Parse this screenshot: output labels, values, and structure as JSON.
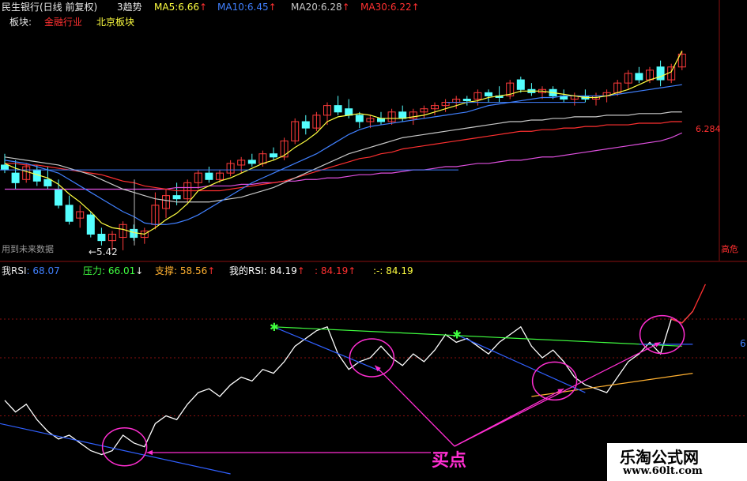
{
  "header": {
    "stock_title": "民生银行(日线 前复权)",
    "indicator_name": "3趋势",
    "ma": [
      {
        "label": "MA5:",
        "value": "6.66",
        "arrow": "↑",
        "color": "#ffff40"
      },
      {
        "label": "MA10:",
        "value": "6.45",
        "arrow": "↑",
        "color": "#4080ff"
      },
      {
        "label": "MA20:",
        "value": "6.28",
        "arrow": "↑",
        "color": "#c8c8c8"
      },
      {
        "label": "MA30:",
        "value": "6.22",
        "arrow": "↑",
        "color": "#ff3030"
      }
    ],
    "sector_label": "板块:",
    "sectors": [
      {
        "name": "金融行业",
        "color": "#ff3030"
      },
      {
        "name": "北京板块",
        "color": "#ffff40"
      }
    ]
  },
  "price_panel": {
    "right_price_label": "6.284",
    "low_label": "←5.42",
    "future_data_label": "用到未来数据",
    "right_edge_label": "高危"
  },
  "rsi_header": {
    "items": [
      {
        "label": "我RSI",
        "value": ": 68.07",
        "color": "#4080ff"
      },
      {
        "label": "压力",
        "value": ": 66.01",
        "arrow": "↓",
        "color": "#40ff40"
      },
      {
        "label": "支撑",
        "value": ": 58.56",
        "arrow": "↑",
        "color": "#ffb030"
      },
      {
        "label": "我的RSI",
        "value": ": 84.19",
        "arrow": "↑",
        "color": "#ffffff"
      },
      {
        "label": "",
        "value": ": 84.19",
        "arrow": "↑",
        "color": "#ff3030"
      },
      {
        "label": ":-",
        "value": ": 84.19",
        "color": "#ffff40"
      }
    ],
    "right_edge_value": "6"
  },
  "annotation": {
    "buy_point": "买点"
  },
  "watermark": {
    "title": "乐淘公式网",
    "url": "www.60lt.com"
  },
  "colors": {
    "up_candle": "#ff3b3b",
    "down_candle": "#54ffff",
    "ma5": "#ffff40",
    "ma10": "#4080ff",
    "ma20": "#c8c8c8",
    "ma30": "#ff3030",
    "long_ma": "#e050e0",
    "rsi": "#ffffff",
    "rsi_hot": "#ff3030",
    "pressure": "#40ff40",
    "support": "#ffb030",
    "trend": "#3060ff",
    "buy": "#ff2ed1"
  },
  "chart_data": {
    "type": "candlestick",
    "candles": [
      {
        "o": 5.95,
        "h": 6.02,
        "l": 5.9,
        "c": 5.92
      },
      {
        "o": 5.9,
        "h": 5.98,
        "l": 5.8,
        "c": 5.84
      },
      {
        "o": 5.86,
        "h": 5.96,
        "l": 5.84,
        "c": 5.94
      },
      {
        "o": 5.92,
        "h": 5.95,
        "l": 5.82,
        "c": 5.85
      },
      {
        "o": 5.86,
        "h": 5.94,
        "l": 5.8,
        "c": 5.82
      },
      {
        "o": 5.8,
        "h": 5.86,
        "l": 5.68,
        "c": 5.7
      },
      {
        "o": 5.7,
        "h": 5.76,
        "l": 5.58,
        "c": 5.6
      },
      {
        "o": 5.62,
        "h": 5.7,
        "l": 5.56,
        "c": 5.66
      },
      {
        "o": 5.64,
        "h": 5.66,
        "l": 5.5,
        "c": 5.52
      },
      {
        "o": 5.52,
        "h": 5.56,
        "l": 5.45,
        "c": 5.48
      },
      {
        "o": 5.48,
        "h": 5.54,
        "l": 5.42,
        "c": 5.52
      },
      {
        "o": 5.5,
        "h": 5.6,
        "l": 5.42,
        "c": 5.58
      },
      {
        "o": 5.55,
        "h": 5.58,
        "l": 5.48,
        "c": 5.5
      },
      {
        "o": 5.5,
        "h": 5.56,
        "l": 5.46,
        "c": 5.54
      },
      {
        "o": 5.58,
        "h": 5.78,
        "l": 5.55,
        "c": 5.7
      },
      {
        "o": 5.68,
        "h": 5.8,
        "l": 5.62,
        "c": 5.76
      },
      {
        "o": 5.76,
        "h": 5.84,
        "l": 5.7,
        "c": 5.74
      },
      {
        "o": 5.74,
        "h": 5.86,
        "l": 5.72,
        "c": 5.84
      },
      {
        "o": 5.84,
        "h": 5.92,
        "l": 5.8,
        "c": 5.9
      },
      {
        "o": 5.9,
        "h": 5.94,
        "l": 5.84,
        "c": 5.86
      },
      {
        "o": 5.86,
        "h": 5.92,
        "l": 5.84,
        "c": 5.9
      },
      {
        "o": 5.9,
        "h": 5.98,
        "l": 5.88,
        "c": 5.96
      },
      {
        "o": 5.95,
        "h": 6.0,
        "l": 5.9,
        "c": 5.98
      },
      {
        "o": 5.98,
        "h": 6.02,
        "l": 5.94,
        "c": 5.96
      },
      {
        "o": 5.96,
        "h": 6.04,
        "l": 5.94,
        "c": 6.02
      },
      {
        "o": 6.02,
        "h": 6.06,
        "l": 5.98,
        "c": 6.0
      },
      {
        "o": 6.0,
        "h": 6.12,
        "l": 5.98,
        "c": 6.1
      },
      {
        "o": 6.1,
        "h": 6.24,
        "l": 6.08,
        "c": 6.22
      },
      {
        "o": 6.22,
        "h": 6.26,
        "l": 6.14,
        "c": 6.18
      },
      {
        "o": 6.18,
        "h": 6.28,
        "l": 6.16,
        "c": 6.26
      },
      {
        "o": 6.26,
        "h": 6.34,
        "l": 6.2,
        "c": 6.32
      },
      {
        "o": 6.32,
        "h": 6.38,
        "l": 6.26,
        "c": 6.28
      },
      {
        "o": 6.3,
        "h": 6.36,
        "l": 6.24,
        "c": 6.26
      },
      {
        "o": 6.26,
        "h": 6.28,
        "l": 6.18,
        "c": 6.22
      },
      {
        "o": 6.22,
        "h": 6.26,
        "l": 6.18,
        "c": 6.24
      },
      {
        "o": 6.24,
        "h": 6.28,
        "l": 6.2,
        "c": 6.22
      },
      {
        "o": 6.22,
        "h": 6.3,
        "l": 6.2,
        "c": 6.28
      },
      {
        "o": 6.28,
        "h": 6.32,
        "l": 6.22,
        "c": 6.24
      },
      {
        "o": 6.24,
        "h": 6.3,
        "l": 6.2,
        "c": 6.28
      },
      {
        "o": 6.28,
        "h": 6.32,
        "l": 6.24,
        "c": 6.3
      },
      {
        "o": 6.3,
        "h": 6.34,
        "l": 6.26,
        "c": 6.32
      },
      {
        "o": 6.32,
        "h": 6.36,
        "l": 6.28,
        "c": 6.34
      },
      {
        "o": 6.34,
        "h": 6.38,
        "l": 6.3,
        "c": 6.36
      },
      {
        "o": 6.36,
        "h": 6.38,
        "l": 6.32,
        "c": 6.35
      },
      {
        "o": 6.36,
        "h": 6.42,
        "l": 6.32,
        "c": 6.4
      },
      {
        "o": 6.4,
        "h": 6.42,
        "l": 6.34,
        "c": 6.38
      },
      {
        "o": 6.38,
        "h": 6.44,
        "l": 6.34,
        "c": 6.37
      },
      {
        "o": 6.38,
        "h": 6.48,
        "l": 6.36,
        "c": 6.46
      },
      {
        "o": 6.48,
        "h": 6.5,
        "l": 6.4,
        "c": 6.42
      },
      {
        "o": 6.42,
        "h": 6.46,
        "l": 6.38,
        "c": 6.4
      },
      {
        "o": 6.4,
        "h": 6.44,
        "l": 6.36,
        "c": 6.42
      },
      {
        "o": 6.42,
        "h": 6.44,
        "l": 6.36,
        "c": 6.38
      },
      {
        "o": 6.38,
        "h": 6.42,
        "l": 6.34,
        "c": 6.36
      },
      {
        "o": 6.36,
        "h": 6.4,
        "l": 6.32,
        "c": 6.38
      },
      {
        "o": 6.38,
        "h": 6.42,
        "l": 6.34,
        "c": 6.36
      },
      {
        "o": 6.36,
        "h": 6.4,
        "l": 6.32,
        "c": 6.38
      },
      {
        "o": 6.38,
        "h": 6.42,
        "l": 6.34,
        "c": 6.4
      },
      {
        "o": 6.4,
        "h": 6.48,
        "l": 6.38,
        "c": 6.46
      },
      {
        "o": 6.46,
        "h": 6.54,
        "l": 6.42,
        "c": 6.52
      },
      {
        "o": 6.52,
        "h": 6.56,
        "l": 6.46,
        "c": 6.48
      },
      {
        "o": 6.48,
        "h": 6.56,
        "l": 6.46,
        "c": 6.54
      },
      {
        "o": 6.56,
        "h": 6.6,
        "l": 6.44,
        "c": 6.48
      },
      {
        "o": 6.48,
        "h": 6.58,
        "l": 6.46,
        "c": 6.56
      },
      {
        "o": 6.56,
        "h": 6.66,
        "l": 6.54,
        "c": 6.64
      }
    ],
    "ma5": [
      5.96,
      5.93,
      5.91,
      5.89,
      5.87,
      5.83,
      5.77,
      5.72,
      5.66,
      5.59,
      5.56,
      5.55,
      5.53,
      5.52,
      5.56,
      5.61,
      5.65,
      5.71,
      5.79,
      5.82,
      5.85,
      5.87,
      5.9,
      5.93,
      5.96,
      5.98,
      6.01,
      6.06,
      6.1,
      6.15,
      6.22,
      6.25,
      6.26,
      6.27,
      6.26,
      6.24,
      6.24,
      6.24,
      6.25,
      6.26,
      6.28,
      6.3,
      6.32,
      6.34,
      6.35,
      6.37,
      6.38,
      6.39,
      6.41,
      6.41,
      6.41,
      6.4,
      6.39,
      6.38,
      6.37,
      6.37,
      6.38,
      6.4,
      6.42,
      6.45,
      6.48,
      6.5,
      6.53,
      6.66
    ],
    "ma10": [
      5.98,
      5.97,
      5.96,
      5.94,
      5.92,
      5.9,
      5.86,
      5.82,
      5.78,
      5.74,
      5.7,
      5.66,
      5.63,
      5.59,
      5.58,
      5.58,
      5.59,
      5.61,
      5.64,
      5.68,
      5.72,
      5.76,
      5.8,
      5.84,
      5.87,
      5.9,
      5.93,
      5.96,
      5.99,
      6.02,
      6.06,
      6.1,
      6.14,
      6.17,
      6.19,
      6.2,
      6.21,
      6.22,
      6.23,
      6.24,
      6.25,
      6.26,
      6.27,
      6.28,
      6.3,
      6.32,
      6.33,
      6.34,
      6.35,
      6.36,
      6.37,
      6.37,
      6.38,
      6.38,
      6.38,
      6.38,
      6.38,
      6.39,
      6.4,
      6.41,
      6.42,
      6.43,
      6.44,
      6.45
    ],
    "ma20": [
      6.0,
      5.99,
      5.98,
      5.97,
      5.96,
      5.95,
      5.93,
      5.91,
      5.89,
      5.86,
      5.83,
      5.8,
      5.78,
      5.76,
      5.74,
      5.73,
      5.72,
      5.72,
      5.72,
      5.72,
      5.73,
      5.74,
      5.75,
      5.77,
      5.79,
      5.81,
      5.84,
      5.87,
      5.9,
      5.93,
      5.96,
      5.99,
      6.02,
      6.04,
      6.06,
      6.08,
      6.1,
      6.12,
      6.13,
      6.14,
      6.15,
      6.16,
      6.17,
      6.18,
      6.19,
      6.2,
      6.21,
      6.22,
      6.22,
      6.23,
      6.23,
      6.24,
      6.24,
      6.25,
      6.25,
      6.25,
      6.26,
      6.26,
      6.26,
      6.27,
      6.27,
      6.27,
      6.28,
      6.28
    ],
    "ma30": [
      5.96,
      5.96,
      5.95,
      5.95,
      5.94,
      5.93,
      5.92,
      5.91,
      5.9,
      5.89,
      5.87,
      5.85,
      5.84,
      5.82,
      5.81,
      5.8,
      5.79,
      5.79,
      5.79,
      5.79,
      5.79,
      5.8,
      5.81,
      5.82,
      5.83,
      5.84,
      5.85,
      5.87,
      5.89,
      5.91,
      5.93,
      5.95,
      5.97,
      5.99,
      6.0,
      6.02,
      6.03,
      6.05,
      6.06,
      6.07,
      6.08,
      6.09,
      6.1,
      6.11,
      6.12,
      6.13,
      6.14,
      6.15,
      6.16,
      6.16,
      6.17,
      6.17,
      6.18,
      6.18,
      6.19,
      6.19,
      6.2,
      6.2,
      6.2,
      6.21,
      6.21,
      6.21,
      6.22,
      6.22
    ],
    "long_ma": [
      5.8,
      5.8,
      5.8,
      5.8,
      5.8,
      5.8,
      5.8,
      5.8,
      5.8,
      5.8,
      5.8,
      5.8,
      5.8,
      5.8,
      5.8,
      5.8,
      5.81,
      5.81,
      5.81,
      5.82,
      5.82,
      5.82,
      5.83,
      5.83,
      5.84,
      5.84,
      5.85,
      5.85,
      5.86,
      5.86,
      5.87,
      5.87,
      5.88,
      5.89,
      5.89,
      5.9,
      5.9,
      5.91,
      5.92,
      5.92,
      5.93,
      5.94,
      5.94,
      5.95,
      5.96,
      5.96,
      5.97,
      5.98,
      5.98,
      5.99,
      6.0,
      6.0,
      6.01,
      6.02,
      6.03,
      6.04,
      6.05,
      6.06,
      6.07,
      6.08,
      6.09,
      6.1,
      6.12,
      6.15
    ],
    "price_range": [
      5.38,
      6.78
    ],
    "rsi": [
      38,
      32,
      36,
      28,
      22,
      18,
      20,
      16,
      12,
      10,
      12,
      20,
      16,
      14,
      26,
      30,
      28,
      36,
      42,
      44,
      40,
      46,
      50,
      48,
      54,
      52,
      58,
      66,
      70,
      74,
      76,
      62,
      54,
      58,
      60,
      66,
      60,
      56,
      62,
      58,
      64,
      72,
      68,
      70,
      66,
      62,
      68,
      72,
      76,
      66,
      60,
      64,
      58,
      50,
      46,
      44,
      42,
      50,
      58,
      62,
      68,
      62,
      80,
      78,
      84
    ],
    "rsi_range": [
      0,
      100
    ]
  }
}
